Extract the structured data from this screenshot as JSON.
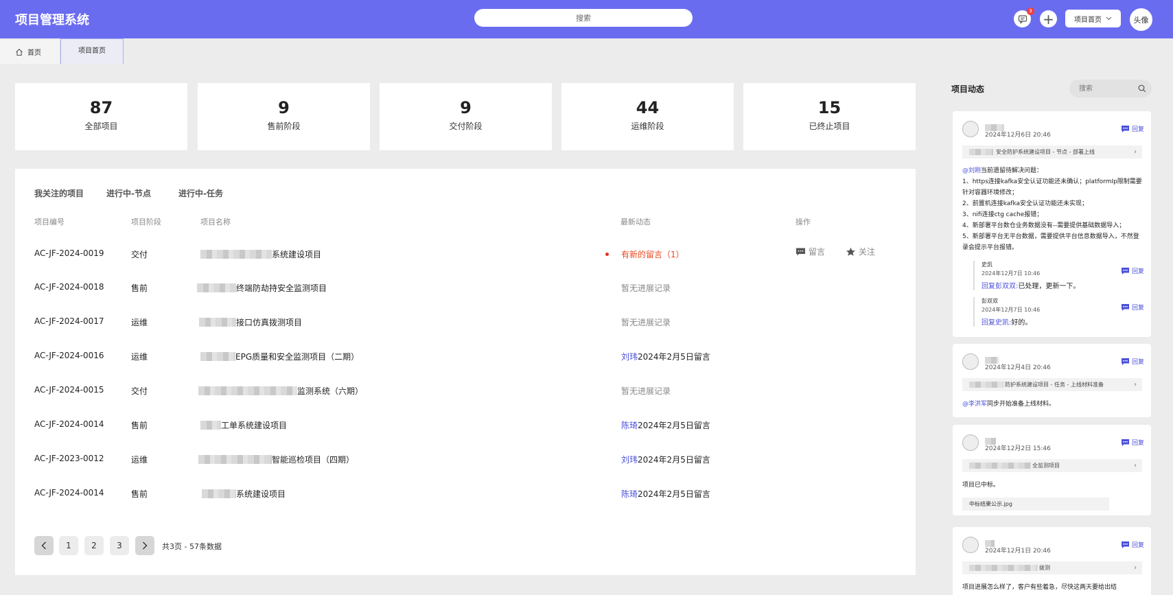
{
  "header": {
    "title": "项目管理系统",
    "search_placeholder": "搜索",
    "message_badge": "3",
    "project_select": "项目首页",
    "avatar": "头像"
  },
  "tabs": [
    {
      "label": "首页"
    },
    {
      "label": "项目首页"
    }
  ],
  "stats": [
    {
      "value": "87",
      "label": "全部项目"
    },
    {
      "value": "9",
      "label": "售前阶段"
    },
    {
      "value": "9",
      "label": "交付阶段"
    },
    {
      "value": "44",
      "label": "运维阶段"
    },
    {
      "value": "15",
      "label": "已终止项目"
    }
  ],
  "main": {
    "subtabs": [
      "我关注的项目",
      "进行中-节点",
      "进行中-任务"
    ],
    "columns": {
      "id": "项目编号",
      "stage": "项目阶段",
      "name": "项目名称",
      "latest": "最新动态",
      "ops": "操作"
    },
    "rows": [
      {
        "id": "AC-JF-2024-0019",
        "stage": "交付",
        "name": "系统建设项目",
        "dyn_text": "有新的留言（1）",
        "dyn_user": "",
        "dyn_type": "new"
      },
      {
        "id": "AC-JF-2024-0018",
        "stage": "售前",
        "name": "终端防劫持安全监测项目",
        "dyn_text": "暂无进展记录",
        "dyn_user": "",
        "dyn_type": "none"
      },
      {
        "id": "AC-JF-2024-0017",
        "stage": "运维",
        "name": "接口仿真拨测项目",
        "dyn_text": "暂无进展记录",
        "dyn_user": "",
        "dyn_type": "none"
      },
      {
        "id": "AC-JF-2024-0016",
        "stage": "运维",
        "name": "EPG质量和安全监测项目（二期）",
        "dyn_text": "2024年2月5日留言",
        "dyn_user": "刘玮",
        "dyn_type": "msg"
      },
      {
        "id": "AC-JF-2024-0015",
        "stage": "交付",
        "name": "监测系统（六期）",
        "dyn_text": "暂无进展记录",
        "dyn_user": "",
        "dyn_type": "none"
      },
      {
        "id": "AC-JF-2024-0014",
        "stage": "售前",
        "name": "工单系统建设项目",
        "dyn_text": "2024年2月5日留言",
        "dyn_user": "陈琦",
        "dyn_type": "msg"
      },
      {
        "id": "AC-JF-2023-0012",
        "stage": "运维",
        "name": "智能巡检项目（四期）",
        "dyn_text": "2024年2月5日留言",
        "dyn_user": "刘玮",
        "dyn_type": "msg"
      },
      {
        "id": "AC-JF-2024-0014",
        "stage": "售前",
        "name": "系统建设项目",
        "dyn_text": "2024年2月5日留言",
        "dyn_user": "陈琦",
        "dyn_type": "msg"
      }
    ],
    "ops": {
      "comment": "留言",
      "follow": "关注"
    },
    "pagination": {
      "pages": [
        "1",
        "2",
        "3"
      ],
      "total": "共3页 - 57条数据"
    }
  },
  "feed_panel": {
    "title": "项目动态",
    "search_placeholder": "搜索",
    "reply_label": "回复",
    "items": [
      {
        "time": "2024年12月6日  20:46",
        "bar": "安全防护系统建设项目 - 节点 - 部署上线",
        "mention": "@刘刚",
        "text_lead": "当前遗留待解决问题：",
        "lines": [
          "1、https连接kafka安全认证功能还未确认；platformIp限制需要针对容器环境修改；",
          "2、前置机连接kafka安全认证功能还未实现；",
          "3、nifi连接ctg cache报错；",
          "4、新部署平台数仓业务数据没有--需要提供基础数据导入；",
          "5、新部署平台无平台数据，需要提供平台信息数据导入，不然登录会提示平台报错。"
        ],
        "replies": [
          {
            "name": "史凯",
            "time": "2024年12月7日  10:46",
            "target": "回复彭双双:",
            "text": "已处理，更新一下。"
          },
          {
            "name": "彭双双",
            "time": "2024年12月7日  10:46",
            "target": "回复史凯:",
            "text": "好的。"
          }
        ]
      },
      {
        "time": "2024年12月4日  20:46",
        "bar": "防护系统建设项目 - 任务 - 上线材料准备",
        "mention": "@李洪军",
        "text": "同步开始准备上线材料。"
      },
      {
        "time": "2024年12月2日  15:46",
        "bar": "全监测项目",
        "text": "项目已中标。",
        "attachment": "中标结果公示.jpg"
      },
      {
        "time": "2024年12月1日  20:46",
        "bar": "拨测",
        "text": "项目进展怎么样了，客户有些着急，尽快这两天要给出结"
      }
    ]
  },
  "colors": {
    "primary": "#6a6cf0",
    "link": "#4a50d8",
    "alert": "#e8481e"
  }
}
